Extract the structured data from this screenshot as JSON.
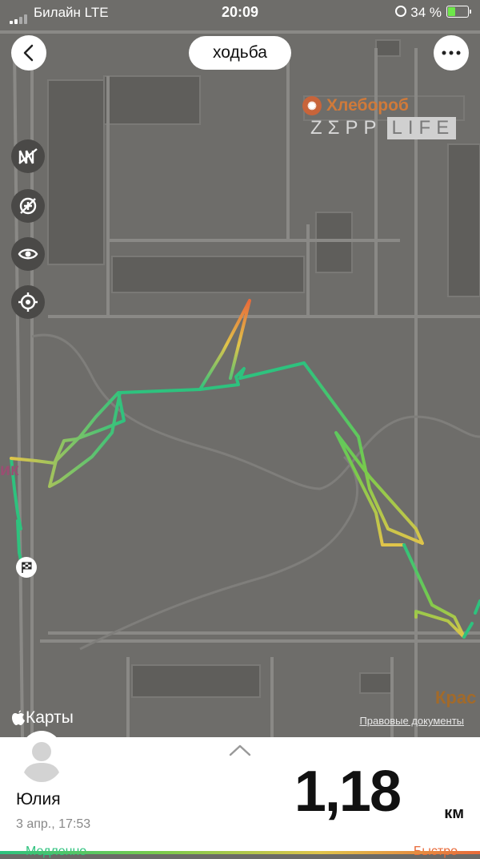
{
  "status_bar": {
    "carrier": "Билайн  LTE",
    "time": "20:09",
    "battery": "34 %"
  },
  "header": {
    "back_icon": "chevron-left-icon",
    "title": "ходьба",
    "more_icon": "ellipsis-icon"
  },
  "map_controls": [
    {
      "icon": "speed-toggle-icon"
    },
    {
      "icon": "pace-off-icon"
    },
    {
      "icon": "eye-icon"
    },
    {
      "icon": "locate-icon"
    }
  ],
  "map": {
    "poi_label": "Хлебороб",
    "watermark_left": "ZΣPP",
    "watermark_right": "LIFE",
    "place_left": "ик",
    "place_right": "Крас",
    "maps_logo": "Карты",
    "legal_link": "Правовые документы"
  },
  "summary": {
    "user_name": "Юлия",
    "date": "3 апр., 17:53",
    "distance": "1,18",
    "unit": "км",
    "legend_slow": "Медленно",
    "legend_fast": "Быстро",
    "colors": {
      "slow": "#2ec27e",
      "medium": "#e0c44a",
      "fast": "#e86a3a"
    }
  }
}
